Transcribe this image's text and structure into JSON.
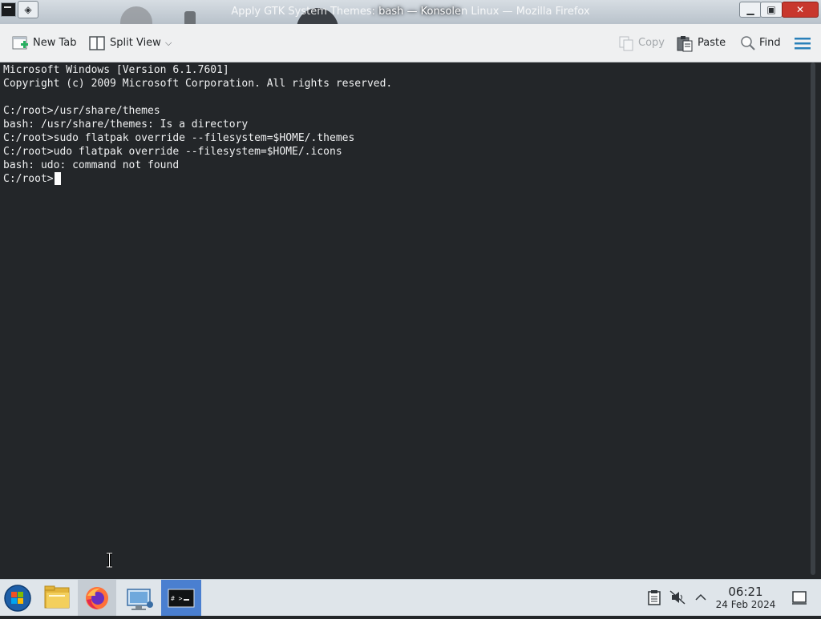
{
  "window": {
    "title_behind": "Apply GTK System Themes to Snaps on Linux — Mozilla Firefox",
    "title_prefix": "Apply GTK System Themes",
    "title_active": ": bash — Konsole",
    "title_suffix": "n Linux — Mozilla Firefox",
    "pin_glyph": "◈",
    "minimize_glyph": "▁",
    "maximize_glyph": "▣",
    "close_glyph": "✕"
  },
  "toolbar": {
    "new_tab_label": "New Tab",
    "split_view_label": "Split View",
    "copy_label": "Copy",
    "paste_label": "Paste",
    "find_label": "Find",
    "split_dropdown_glyph": "⌵"
  },
  "terminal": {
    "lines": [
      "Microsoft Windows [Version 6.1.7601]",
      "Copyright (c) 2009 Microsoft Corporation. All rights reserved.",
      "",
      "C:/root>/usr/share/themes",
      "bash: /usr/share/themes: Is a directory",
      "C:/root>sudo flatpak override --filesystem=$HOME/.themes",
      "C:/root>udo flatpak override --filesystem=$HOME/.icons",
      "bash: udo: command not found",
      "C:/root>"
    ],
    "background": "#232629",
    "foreground": "#eff0f1"
  },
  "taskbar": {
    "items": [
      {
        "name": "start-menu",
        "icon": "windows-orb-icon"
      },
      {
        "name": "file-manager",
        "icon": "folder-icon"
      },
      {
        "name": "firefox",
        "icon": "firefox-icon"
      },
      {
        "name": "network",
        "icon": "network-computer-icon"
      },
      {
        "name": "konsole",
        "icon": "terminal-icon"
      }
    ],
    "clock": {
      "time": "06:21",
      "date": "24 Feb 2024"
    },
    "tray_icons": [
      "clipboard-icon",
      "muted-volume-icon",
      "expand-arrow-icon",
      "show-desktop-icon"
    ]
  },
  "colors": {
    "terminal_bg": "#232629",
    "toolbar_bg": "#eff0f1",
    "taskbar_bg": "#dfe5ea",
    "active_task": "#4a7fd0",
    "close_button": "#c8372d"
  }
}
